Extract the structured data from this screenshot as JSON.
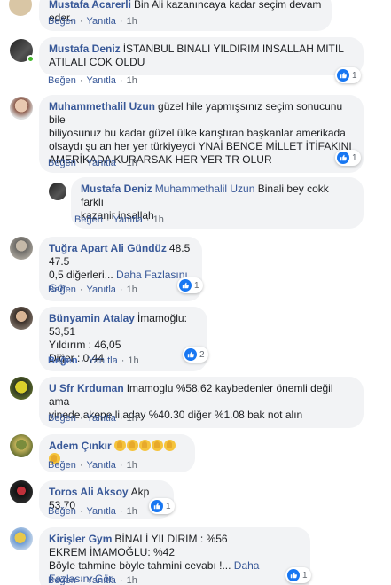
{
  "actions": {
    "like": "Beğen",
    "reply": "Yanıtla",
    "sep": "·"
  },
  "comments": [
    {
      "author": "Mustafa Acarerli",
      "text": "Bin Ali kazanıncaya kadar seçim devam eder..",
      "time": "1h"
    },
    {
      "author": "Mustafa Deniz",
      "lines": [
        "İSTANBUL BINALI YILDIRIM INSALLAH MITIL",
        "ATILALI COK OLDU"
      ],
      "time": "1h",
      "likes": "1"
    },
    {
      "author": "Muhammethalil Uzun",
      "lines": [
        "güzel hile yapmışsınız seçim sonucunu bile",
        "biliyosunuz bu kadar güzel ülke karıştıran başkanlar amerikada",
        "olsaydı şu an her yer türkiyeydi YNAİ BENCE MİLLET İTİFAKINI",
        "AMERİKADA KURARSAK HER YER TR OLUR"
      ],
      "time": "1h",
      "likes": "1"
    },
    {
      "author": "Mustafa Deniz",
      "mention": "Muhammethalil Uzun",
      "lines": [
        "Binali bey cokk farklı",
        "kazanir insallah"
      ],
      "time": "1h"
    },
    {
      "author": "Tuğra Apart Ali Gündüz",
      "lines": [
        "48.5",
        "47.5",
        "0,5 diğerleri..."
      ],
      "more": "Daha Fazlasını Gör",
      "time": "1h",
      "likes": "1"
    },
    {
      "author": "Bünyamin Atalay",
      "lines": [
        "İmamoğlu: 53,51",
        "Yıldırım : 46,05",
        "Diğer : 0,44"
      ],
      "time": "1h",
      "likes": "2"
    },
    {
      "author": "U Sfr Krduman",
      "lines": [
        "Imamoglu %58.62 kaybedenler önemli değil ama",
        "yinede akepe li aday %40.30 diğer %1.08 bak not alın"
      ],
      "time": "1h"
    },
    {
      "author": "Adem Çınkır",
      "emoji_count": 6,
      "time": "1h"
    },
    {
      "author": "Toros Ali Aksoy",
      "text": "Akp 53.70",
      "time": "1h",
      "likes": "1"
    },
    {
      "author": "Kirişler Gym",
      "lines": [
        "BİNALİ YILDIRIM : %56",
        "EKREM İMAMOĞLU: %42",
        "Böyle tahmine böyle tahmini cevabı !..."
      ],
      "more": "Daha Fazlasını Gör",
      "time": "1h",
      "likes": "1"
    }
  ],
  "colors": {
    "link": "#385898",
    "bubble": "#f2f3f5",
    "like": "#1877f2",
    "online": "#42b72a"
  }
}
